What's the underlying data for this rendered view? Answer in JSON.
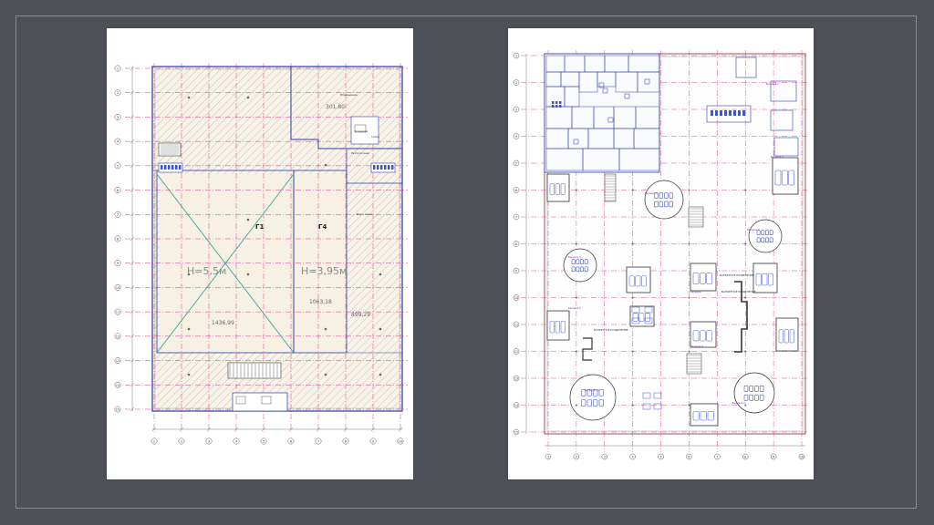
{
  "slides": {
    "left_plan": {
      "row_axes": [
        "1",
        "2",
        "3",
        "4",
        "5",
        "6",
        "7",
        "8",
        "9",
        "10",
        "11",
        "12",
        "13",
        "14",
        "15"
      ],
      "col_axes": [
        "1",
        "2",
        "3",
        "4",
        "5",
        "6",
        "7",
        "8",
        "9",
        "10"
      ],
      "zones": [
        {
          "id": "zone-a",
          "height_label": "H=5,5м",
          "area": "1436,99",
          "marker": "Г1"
        },
        {
          "id": "zone-b",
          "height_label": "H=3,95м",
          "area": "1063,18",
          "marker": "Г4"
        }
      ],
      "areas_misc": [
        "301,80",
        "899,29"
      ],
      "room_labels": [
        "Помещение",
        "Кладовая",
        "Склад",
        "Разгрузочная",
        "Пож. отсек"
      ],
      "colors": {
        "axis": "#d23c8c",
        "wall": "#2a3ea8",
        "hatch": "#d9a7a7",
        "cross": "#38a69c",
        "zone_fill": "#f6f4e8"
      }
    },
    "right_plan": {
      "row_axes": [
        "1",
        "2",
        "3",
        "4",
        "5",
        "6",
        "7",
        "8",
        "9",
        "10",
        "11",
        "12",
        "13",
        "14",
        "15"
      ],
      "col_axes": [
        "1",
        "2",
        "3",
        "4",
        "5",
        "6",
        "7",
        "8",
        "9",
        "10"
      ],
      "zone_labels": [
        "Беседка 1",
        "Беседка 2",
        "Беседка 3",
        "Беседка 4",
        "Беседка 5",
        "Беседка 6",
        "Беседка 7",
        "Беседка 8",
        "Беседка 9",
        "Беседка 10"
      ],
      "area_labels": [
        "БАНКЕТНОЕ РАЗДЕЛЕНИЕ",
        "БАНКЕТНОЕ РАЗДЕЛЕНИЕ",
        "БАНКЕТНОЕ РАЗДЕЛЕНИЕ"
      ],
      "colors": {
        "axis": "#d23c8c",
        "wall": "#2a3ea8",
        "furniture": "#3c54d8",
        "label": "#7a2ab0"
      }
    }
  }
}
